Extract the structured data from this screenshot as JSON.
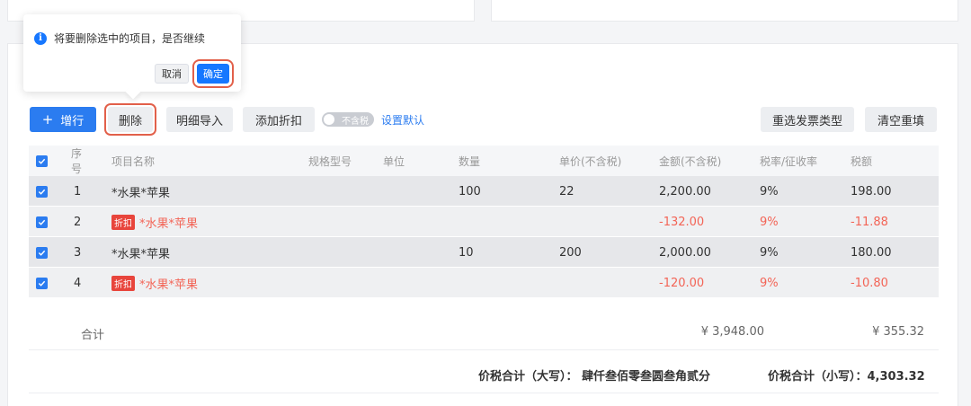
{
  "popconfirm": {
    "message": "将要删除选中的项目，是否继续",
    "cancel_label": "取消",
    "ok_label": "确定"
  },
  "toolbar": {
    "add_label": "增行",
    "delete_label": "删除",
    "import_label": "明细导入",
    "discount_label": "添加折扣",
    "tax_toggle_label": "不含税",
    "set_default_label": "设置默认",
    "reselect_label": "重选发票类型",
    "clear_label": "清空重填"
  },
  "table": {
    "headers": {
      "no": "序号",
      "name": "项目名称",
      "spec": "规格型号",
      "unit": "单位",
      "qty": "数量",
      "price": "单价(不含税)",
      "amount": "金额(不含税)",
      "rate": "税率/征收率",
      "tax": "税额"
    },
    "discount_tag": "折扣",
    "rows": [
      {
        "no": "1",
        "name": "*水果*苹果",
        "spec": "",
        "unit": "",
        "qty": "100",
        "price": "22",
        "amount": "2,200.00",
        "rate": "9%",
        "tax": "198.00",
        "discount": false,
        "checked": true
      },
      {
        "no": "2",
        "name": "*水果*苹果",
        "spec": "",
        "unit": "",
        "qty": "",
        "price": "",
        "amount": "-132.00",
        "rate": "9%",
        "tax": "-11.88",
        "discount": true,
        "checked": true
      },
      {
        "no": "3",
        "name": "*水果*苹果",
        "spec": "",
        "unit": "",
        "qty": "10",
        "price": "200",
        "amount": "2,000.00",
        "rate": "9%",
        "tax": "180.00",
        "discount": false,
        "checked": true
      },
      {
        "no": "4",
        "name": "*水果*苹果",
        "spec": "",
        "unit": "",
        "qty": "",
        "price": "",
        "amount": "-120.00",
        "rate": "9%",
        "tax": "-10.80",
        "discount": true,
        "checked": true
      }
    ]
  },
  "summary": {
    "label": "合计",
    "amount_total": "¥ 3,948.00",
    "tax_total": "¥ 355.32"
  },
  "grand_total": {
    "upper_text": "价税合计（大写）：  肆仟叁佰零叁圆叁角贰分",
    "lower_text": "价税合计（小写）：4,303.32"
  },
  "colors": {
    "accent": "#2b7cf0",
    "highlight_outline": "#e2604a",
    "discount_text": "#f36456",
    "discount_tag": "#e8453c"
  }
}
